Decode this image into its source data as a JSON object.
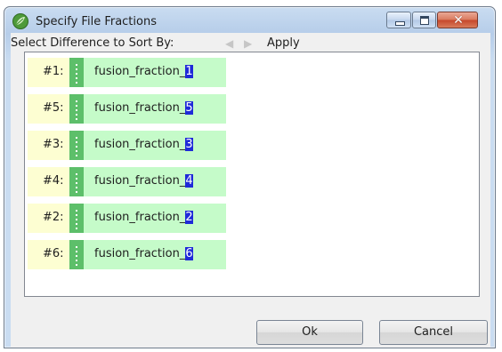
{
  "window": {
    "title": "Specify File Fractions",
    "icon": "app-leaf-icon",
    "controls": {
      "minimize": "minimize-icon",
      "maximize": "maximize-icon",
      "close": "close-icon",
      "close_glyph": "✕"
    }
  },
  "toolbar": {
    "sort_label": "Select Difference to Sort By:",
    "prev_glyph": "◀",
    "next_glyph": "▶",
    "apply_label": "Apply"
  },
  "fractions": [
    {
      "rank": "#1:",
      "name": "fusion_fraction_",
      "suffix": "1"
    },
    {
      "rank": "#5:",
      "name": "fusion_fraction_",
      "suffix": "5"
    },
    {
      "rank": "#3:",
      "name": "fusion_fraction_",
      "suffix": "3"
    },
    {
      "rank": "#4:",
      "name": "fusion_fraction_",
      "suffix": "4"
    },
    {
      "rank": "#2:",
      "name": "fusion_fraction_",
      "suffix": "2"
    },
    {
      "rank": "#6:",
      "name": "fusion_fraction_",
      "suffix": "6"
    }
  ],
  "footer": {
    "ok_label": "Ok",
    "cancel_label": "Cancel"
  },
  "colors": {
    "item_rank_bg": "#fdfed2",
    "item_body_bg": "#c5fbc9",
    "grip": "#5dbf6a",
    "highlight": "#1f2ad8"
  }
}
